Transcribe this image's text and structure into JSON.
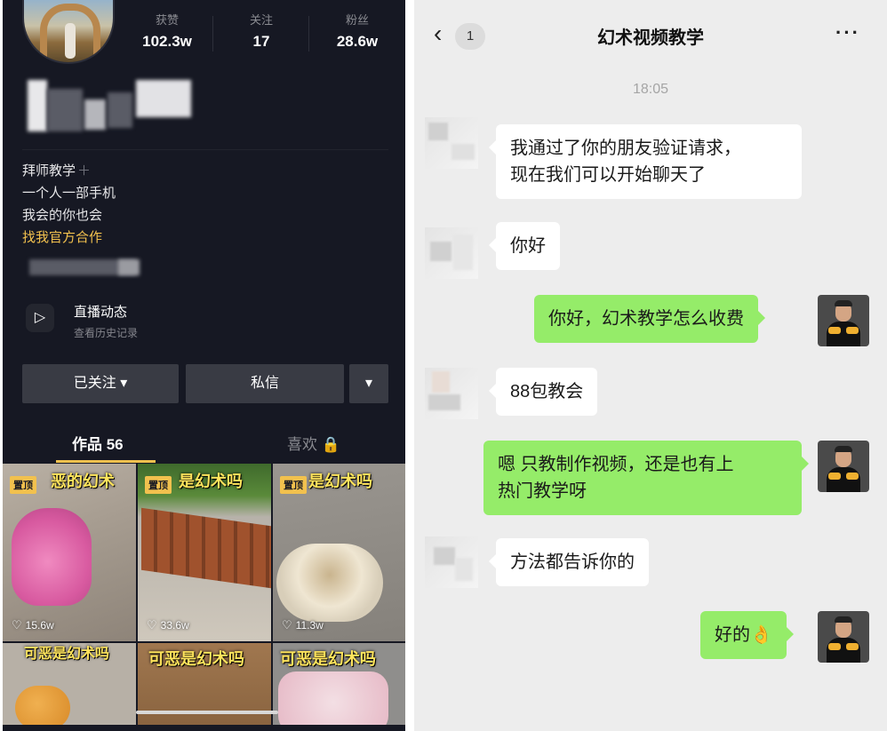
{
  "profile": {
    "stats": [
      {
        "label": "获赞",
        "value": "102.3w"
      },
      {
        "label": "关注",
        "value": "17"
      },
      {
        "label": "粉丝",
        "value": "28.6w"
      }
    ],
    "bio_lines": [
      "拜师教学",
      "一个人一部手机",
      "我会的你也会"
    ],
    "bio_link": "找我官方合作",
    "live_title": "直播动态",
    "live_subtitle": "查看历史记录",
    "follow_button": "已关注 ▾",
    "message_button": "私信",
    "more_button": "▾",
    "tab_works": "作品 56",
    "tab_likes": "喜欢 🔒",
    "videos": [
      {
        "caption": "恶的幻术",
        "pinned": "置顶",
        "likes": "15.6w"
      },
      {
        "caption": "是幻术吗",
        "pinned": "置顶",
        "likes": "33.6w"
      },
      {
        "caption": "是幻术吗",
        "pinned": "置顶",
        "likes": "11.3w"
      },
      {
        "caption": "可恶是幻术吗"
      },
      {
        "caption": "可恶是幻术吗"
      },
      {
        "caption": "可恶是幻术吗"
      }
    ]
  },
  "chat": {
    "back_badge": "1",
    "title": "幻术视频教学",
    "more_icon": "···",
    "timestamp": "18:05",
    "messages": [
      {
        "side": "in",
        "text_line1": "我通过了你的朋友验证请求，",
        "text_line2": "现在我们可以开始聊天了"
      },
      {
        "side": "in",
        "text": "你好"
      },
      {
        "side": "out",
        "text": "你好，幻术教学怎么收费"
      },
      {
        "side": "in",
        "text": "88包教会"
      },
      {
        "side": "out",
        "text_line1": "嗯 只教制作视频，还是也有上",
        "text_line2": "热门教学呀"
      },
      {
        "side": "in",
        "text": "方法都告诉你的"
      },
      {
        "side": "out",
        "text": "好的👌"
      }
    ]
  },
  "colors": {
    "bubble_out": "#95ec69",
    "profile_bg": "#161823",
    "accent_gold": "#f2c14e"
  },
  "icons": [
    "back-arrow-icon",
    "more-icon",
    "live-replay-icon",
    "heart-icon",
    "lock-icon",
    "dropdown-icon"
  ]
}
